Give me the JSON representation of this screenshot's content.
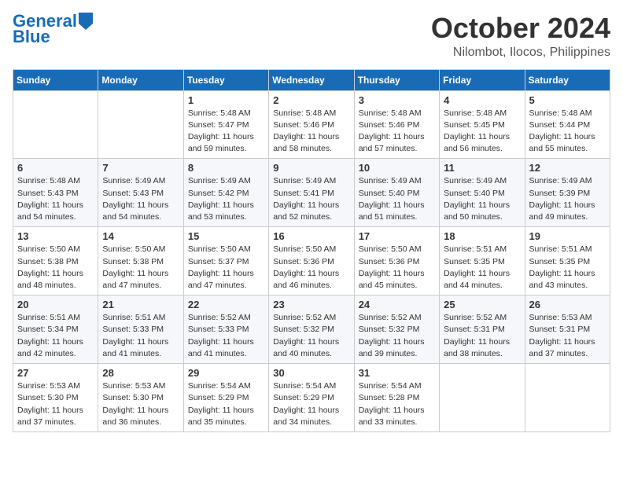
{
  "header": {
    "logo_line1": "General",
    "logo_line2": "Blue",
    "month": "October 2024",
    "location": "Nilombot, Ilocos, Philippines"
  },
  "weekdays": [
    "Sunday",
    "Monday",
    "Tuesday",
    "Wednesday",
    "Thursday",
    "Friday",
    "Saturday"
  ],
  "weeks": [
    [
      {
        "day": "",
        "info": ""
      },
      {
        "day": "",
        "info": ""
      },
      {
        "day": "1",
        "info": "Sunrise: 5:48 AM\nSunset: 5:47 PM\nDaylight: 11 hours and 59 minutes."
      },
      {
        "day": "2",
        "info": "Sunrise: 5:48 AM\nSunset: 5:46 PM\nDaylight: 11 hours and 58 minutes."
      },
      {
        "day": "3",
        "info": "Sunrise: 5:48 AM\nSunset: 5:46 PM\nDaylight: 11 hours and 57 minutes."
      },
      {
        "day": "4",
        "info": "Sunrise: 5:48 AM\nSunset: 5:45 PM\nDaylight: 11 hours and 56 minutes."
      },
      {
        "day": "5",
        "info": "Sunrise: 5:48 AM\nSunset: 5:44 PM\nDaylight: 11 hours and 55 minutes."
      }
    ],
    [
      {
        "day": "6",
        "info": "Sunrise: 5:48 AM\nSunset: 5:43 PM\nDaylight: 11 hours and 54 minutes."
      },
      {
        "day": "7",
        "info": "Sunrise: 5:49 AM\nSunset: 5:43 PM\nDaylight: 11 hours and 54 minutes."
      },
      {
        "day": "8",
        "info": "Sunrise: 5:49 AM\nSunset: 5:42 PM\nDaylight: 11 hours and 53 minutes."
      },
      {
        "day": "9",
        "info": "Sunrise: 5:49 AM\nSunset: 5:41 PM\nDaylight: 11 hours and 52 minutes."
      },
      {
        "day": "10",
        "info": "Sunrise: 5:49 AM\nSunset: 5:40 PM\nDaylight: 11 hours and 51 minutes."
      },
      {
        "day": "11",
        "info": "Sunrise: 5:49 AM\nSunset: 5:40 PM\nDaylight: 11 hours and 50 minutes."
      },
      {
        "day": "12",
        "info": "Sunrise: 5:49 AM\nSunset: 5:39 PM\nDaylight: 11 hours and 49 minutes."
      }
    ],
    [
      {
        "day": "13",
        "info": "Sunrise: 5:50 AM\nSunset: 5:38 PM\nDaylight: 11 hours and 48 minutes."
      },
      {
        "day": "14",
        "info": "Sunrise: 5:50 AM\nSunset: 5:38 PM\nDaylight: 11 hours and 47 minutes."
      },
      {
        "day": "15",
        "info": "Sunrise: 5:50 AM\nSunset: 5:37 PM\nDaylight: 11 hours and 47 minutes."
      },
      {
        "day": "16",
        "info": "Sunrise: 5:50 AM\nSunset: 5:36 PM\nDaylight: 11 hours and 46 minutes."
      },
      {
        "day": "17",
        "info": "Sunrise: 5:50 AM\nSunset: 5:36 PM\nDaylight: 11 hours and 45 minutes."
      },
      {
        "day": "18",
        "info": "Sunrise: 5:51 AM\nSunset: 5:35 PM\nDaylight: 11 hours and 44 minutes."
      },
      {
        "day": "19",
        "info": "Sunrise: 5:51 AM\nSunset: 5:35 PM\nDaylight: 11 hours and 43 minutes."
      }
    ],
    [
      {
        "day": "20",
        "info": "Sunrise: 5:51 AM\nSunset: 5:34 PM\nDaylight: 11 hours and 42 minutes."
      },
      {
        "day": "21",
        "info": "Sunrise: 5:51 AM\nSunset: 5:33 PM\nDaylight: 11 hours and 41 minutes."
      },
      {
        "day": "22",
        "info": "Sunrise: 5:52 AM\nSunset: 5:33 PM\nDaylight: 11 hours and 41 minutes."
      },
      {
        "day": "23",
        "info": "Sunrise: 5:52 AM\nSunset: 5:32 PM\nDaylight: 11 hours and 40 minutes."
      },
      {
        "day": "24",
        "info": "Sunrise: 5:52 AM\nSunset: 5:32 PM\nDaylight: 11 hours and 39 minutes."
      },
      {
        "day": "25",
        "info": "Sunrise: 5:52 AM\nSunset: 5:31 PM\nDaylight: 11 hours and 38 minutes."
      },
      {
        "day": "26",
        "info": "Sunrise: 5:53 AM\nSunset: 5:31 PM\nDaylight: 11 hours and 37 minutes."
      }
    ],
    [
      {
        "day": "27",
        "info": "Sunrise: 5:53 AM\nSunset: 5:30 PM\nDaylight: 11 hours and 37 minutes."
      },
      {
        "day": "28",
        "info": "Sunrise: 5:53 AM\nSunset: 5:30 PM\nDaylight: 11 hours and 36 minutes."
      },
      {
        "day": "29",
        "info": "Sunrise: 5:54 AM\nSunset: 5:29 PM\nDaylight: 11 hours and 35 minutes."
      },
      {
        "day": "30",
        "info": "Sunrise: 5:54 AM\nSunset: 5:29 PM\nDaylight: 11 hours and 34 minutes."
      },
      {
        "day": "31",
        "info": "Sunrise: 5:54 AM\nSunset: 5:28 PM\nDaylight: 11 hours and 33 minutes."
      },
      {
        "day": "",
        "info": ""
      },
      {
        "day": "",
        "info": ""
      }
    ]
  ]
}
